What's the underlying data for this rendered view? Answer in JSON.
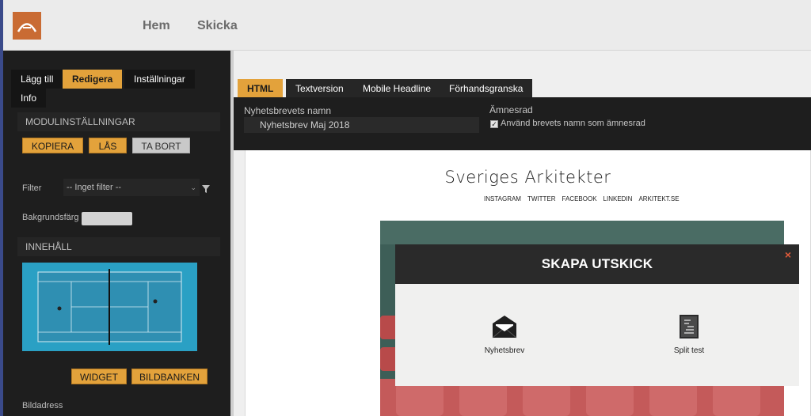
{
  "topnav": {
    "items": [
      "Hem",
      "Skicka"
    ]
  },
  "leftpanel": {
    "tabs": [
      "Lägg till",
      "Redigera",
      "Inställningar",
      "Info"
    ],
    "module_settings_title": "MODULINSTÄLLNINGAR",
    "buttons": {
      "copy": "KOPIERA",
      "lock": "LÅS",
      "delete": "TA BORT"
    },
    "filter_label": "Filter",
    "filter_value": "-- Inget filter --",
    "bg_color_label": "Bakgrundsfärg",
    "content_title": "INNEHÅLL",
    "widget_button": "WIDGET",
    "image_bank_button": "BILDBANKEN",
    "image_address_label": "Bildadress"
  },
  "main": {
    "tabs": [
      "HTML",
      "Textversion",
      "Mobile Headline",
      "Förhandsgranska"
    ],
    "newsletter_name_label": "Nyhetsbrevets namn",
    "newsletter_name_value": "Nyhetsbrev Maj 2018",
    "subject_label": "Ämnesrad",
    "use_name_checkbox": "Använd brevets namn som ämnesrad",
    "use_name_checked": true
  },
  "preview": {
    "brand": "Sveriges Arkitekter",
    "links": [
      "INSTAGRAM",
      "TWITTER",
      "FACEBOOK",
      "LINKEDIN",
      "ARKITEKT.SE"
    ]
  },
  "modal": {
    "title": "SKAPA UTSKICK",
    "close": "×",
    "options": [
      {
        "label": "Nyhetsbrev",
        "icon": "envelope-icon"
      },
      {
        "label": "Split test",
        "icon": "split-test-icon"
      }
    ]
  },
  "colors": {
    "accent": "#e3a23b",
    "dark_panel": "#1e1e1e",
    "logo": "#c96b33",
    "close": "#e05a3a",
    "court": "#2aa0c4"
  }
}
